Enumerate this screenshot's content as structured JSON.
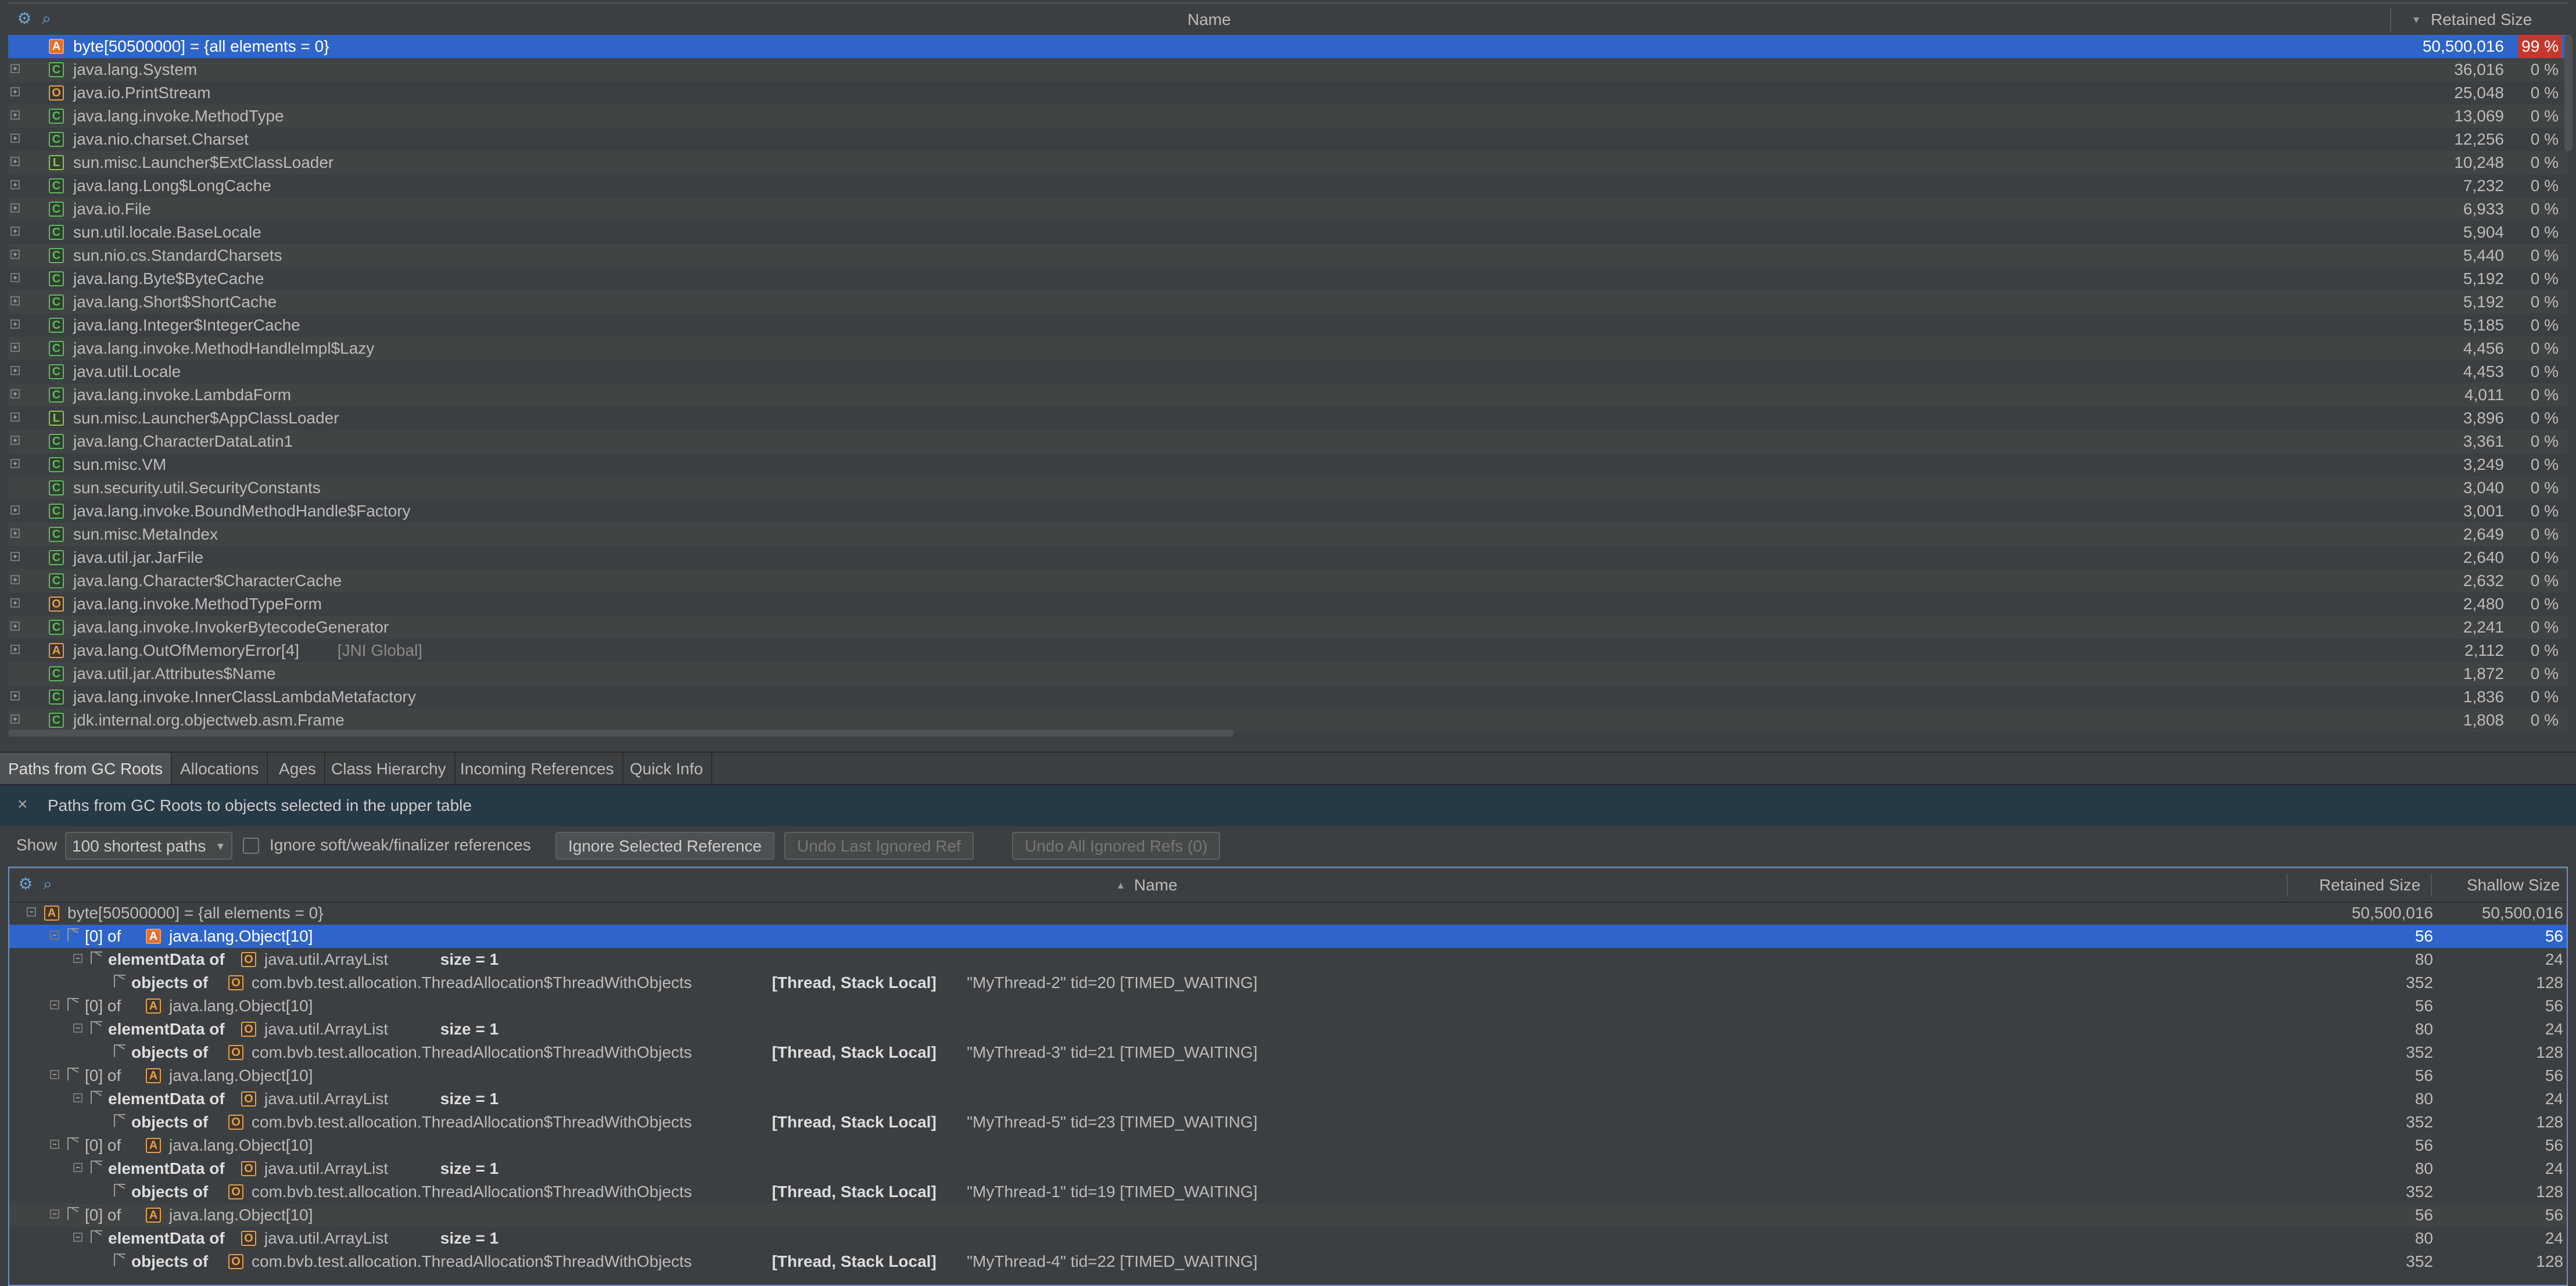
{
  "upper": {
    "header": {
      "name": "Name",
      "retained": "Retained Size",
      "sort_icon": "sort-desc-icon"
    },
    "rows": [
      {
        "kind": "A",
        "name": "byte[50500000] = {all elements = 0}",
        "tag": "",
        "size": "50,500,016",
        "pct": "99 %",
        "expander": "none",
        "selected": true
      },
      {
        "kind": "C",
        "name": "java.lang.System",
        "tag": "",
        "size": "36,016",
        "pct": "0 %",
        "expander": "plus"
      },
      {
        "kind": "O",
        "name": "java.io.PrintStream",
        "tag": "",
        "size": "25,048",
        "pct": "0 %",
        "expander": "plus"
      },
      {
        "kind": "C",
        "name": "java.lang.invoke.MethodType",
        "tag": "",
        "size": "13,069",
        "pct": "0 %",
        "expander": "plus"
      },
      {
        "kind": "C",
        "name": "java.nio.charset.Charset",
        "tag": "",
        "size": "12,256",
        "pct": "0 %",
        "expander": "plus"
      },
      {
        "kind": "L",
        "name": "sun.misc.Launcher$ExtClassLoader",
        "tag": "",
        "size": "10,248",
        "pct": "0 %",
        "expander": "plus"
      },
      {
        "kind": "C",
        "name": "java.lang.Long$LongCache",
        "tag": "",
        "size": "7,232",
        "pct": "0 %",
        "expander": "plus"
      },
      {
        "kind": "C",
        "name": "java.io.File",
        "tag": "",
        "size": "6,933",
        "pct": "0 %",
        "expander": "plus"
      },
      {
        "kind": "C",
        "name": "sun.util.locale.BaseLocale",
        "tag": "",
        "size": "5,904",
        "pct": "0 %",
        "expander": "plus"
      },
      {
        "kind": "C",
        "name": "sun.nio.cs.StandardCharsets",
        "tag": "",
        "size": "5,440",
        "pct": "0 %",
        "expander": "plus"
      },
      {
        "kind": "C",
        "name": "java.lang.Byte$ByteCache",
        "tag": "",
        "size": "5,192",
        "pct": "0 %",
        "expander": "plus"
      },
      {
        "kind": "C",
        "name": "java.lang.Short$ShortCache",
        "tag": "",
        "size": "5,192",
        "pct": "0 %",
        "expander": "plus"
      },
      {
        "kind": "C",
        "name": "java.lang.Integer$IntegerCache",
        "tag": "",
        "size": "5,185",
        "pct": "0 %",
        "expander": "plus"
      },
      {
        "kind": "C",
        "name": "java.lang.invoke.MethodHandleImpl$Lazy",
        "tag": "",
        "size": "4,456",
        "pct": "0 %",
        "expander": "plus"
      },
      {
        "kind": "C",
        "name": "java.util.Locale",
        "tag": "",
        "size": "4,453",
        "pct": "0 %",
        "expander": "plus"
      },
      {
        "kind": "C",
        "name": "java.lang.invoke.LambdaForm",
        "tag": "",
        "size": "4,011",
        "pct": "0 %",
        "expander": "plus"
      },
      {
        "kind": "L",
        "name": "sun.misc.Launcher$AppClassLoader",
        "tag": "",
        "size": "3,896",
        "pct": "0 %",
        "expander": "plus"
      },
      {
        "kind": "C",
        "name": "java.lang.CharacterDataLatin1",
        "tag": "",
        "size": "3,361",
        "pct": "0 %",
        "expander": "plus"
      },
      {
        "kind": "C",
        "name": "sun.misc.VM",
        "tag": "",
        "size": "3,249",
        "pct": "0 %",
        "expander": "plus"
      },
      {
        "kind": "C",
        "name": "sun.security.util.SecurityConstants",
        "tag": "",
        "size": "3,040",
        "pct": "0 %",
        "expander": "none"
      },
      {
        "kind": "C",
        "name": "java.lang.invoke.BoundMethodHandle$Factory",
        "tag": "",
        "size": "3,001",
        "pct": "0 %",
        "expander": "plus"
      },
      {
        "kind": "C",
        "name": "sun.misc.MetaIndex",
        "tag": "",
        "size": "2,649",
        "pct": "0 %",
        "expander": "plus"
      },
      {
        "kind": "C",
        "name": "java.util.jar.JarFile",
        "tag": "",
        "size": "2,640",
        "pct": "0 %",
        "expander": "plus"
      },
      {
        "kind": "C",
        "name": "java.lang.Character$CharacterCache",
        "tag": "",
        "size": "2,632",
        "pct": "0 %",
        "expander": "plus"
      },
      {
        "kind": "O",
        "name": "java.lang.invoke.MethodTypeForm",
        "tag": "",
        "size": "2,480",
        "pct": "0 %",
        "expander": "plus"
      },
      {
        "kind": "C",
        "name": "java.lang.invoke.InvokerBytecodeGenerator",
        "tag": "",
        "size": "2,241",
        "pct": "0 %",
        "expander": "plus"
      },
      {
        "kind": "A",
        "name": "java.lang.OutOfMemoryError[4]",
        "tag": "[JNI Global]",
        "size": "2,112",
        "pct": "0 %",
        "expander": "plus"
      },
      {
        "kind": "C",
        "name": "java.util.jar.Attributes$Name",
        "tag": "",
        "size": "1,872",
        "pct": "0 %",
        "expander": "none"
      },
      {
        "kind": "C",
        "name": "java.lang.invoke.InnerClassLambdaMetafactory",
        "tag": "",
        "size": "1,836",
        "pct": "0 %",
        "expander": "plus"
      },
      {
        "kind": "C",
        "name": "jdk.internal.org.objectweb.asm.Frame",
        "tag": "",
        "size": "1,808",
        "pct": "0 %",
        "expander": "plus"
      }
    ]
  },
  "tabs": [
    {
      "label": "Paths from GC Roots",
      "active": true
    },
    {
      "label": "Allocations",
      "active": false
    },
    {
      "label": "Ages",
      "active": false
    },
    {
      "label": "Class Hierarchy",
      "active": false
    },
    {
      "label": "Incoming References",
      "active": false
    },
    {
      "label": "Quick Info",
      "active": false
    }
  ],
  "info": {
    "close": "×",
    "text": "Paths from GC Roots to objects selected in the upper table"
  },
  "toolbar": {
    "show_label": "Show",
    "show_value": "100 shortest paths",
    "ignore_soft_label": "Ignore soft/weak/finalizer references",
    "ignore_selected": "Ignore Selected Reference",
    "undo_last": "Undo Last Ignored Ref",
    "undo_all": "Undo All Ignored Refs (0)"
  },
  "lower": {
    "header": {
      "name": "Name",
      "retained": "Retained Size",
      "shallow": "Shallow Size",
      "sort_icon": "sort-asc-icon"
    },
    "rows": [
      {
        "level": 0,
        "kind": "A",
        "field": "",
        "name": "byte[50500000] = {all elements = 0}",
        "extra": "",
        "tag": "",
        "retained": "50,500,016",
        "shallow": "50,500,016",
        "expander": "minus"
      },
      {
        "level": 1,
        "kind": "A",
        "field": "[0] of",
        "name": "java.lang.Object[10]",
        "extra": "",
        "tag": "",
        "retained": "56",
        "shallow": "56",
        "expander": "minus",
        "selected": true
      },
      {
        "level": 2,
        "kind": "O",
        "field": "elementData of",
        "name": "java.util.ArrayList",
        "extra": "size = 1",
        "tag": "",
        "retained": "80",
        "shallow": "24",
        "expander": "minus",
        "boldfield": true
      },
      {
        "level": 3,
        "kind": "O",
        "field": "objects of",
        "name": "com.bvb.test.allocation.ThreadAllocation$ThreadWithObjects",
        "extra": "",
        "tag": "[Thread, Stack Local]",
        "tail": "\"MyThread-2\" tid=20 [TIMED_WAITING]",
        "retained": "352",
        "shallow": "128",
        "expander": "none",
        "boldfield": true
      },
      {
        "level": 1,
        "kind": "A",
        "field": "[0] of",
        "name": "java.lang.Object[10]",
        "extra": "",
        "tag": "",
        "retained": "56",
        "shallow": "56",
        "expander": "minus"
      },
      {
        "level": 2,
        "kind": "O",
        "field": "elementData of",
        "name": "java.util.ArrayList",
        "extra": "size = 1",
        "tag": "",
        "retained": "80",
        "shallow": "24",
        "expander": "minus",
        "boldfield": true
      },
      {
        "level": 3,
        "kind": "O",
        "field": "objects of",
        "name": "com.bvb.test.allocation.ThreadAllocation$ThreadWithObjects",
        "extra": "",
        "tag": "[Thread, Stack Local]",
        "tail": "\"MyThread-3\" tid=21 [TIMED_WAITING]",
        "retained": "352",
        "shallow": "128",
        "expander": "none",
        "boldfield": true
      },
      {
        "level": 1,
        "kind": "A",
        "field": "[0] of",
        "name": "java.lang.Object[10]",
        "extra": "",
        "tag": "",
        "retained": "56",
        "shallow": "56",
        "expander": "minus"
      },
      {
        "level": 2,
        "kind": "O",
        "field": "elementData of",
        "name": "java.util.ArrayList",
        "extra": "size = 1",
        "tag": "",
        "retained": "80",
        "shallow": "24",
        "expander": "minus",
        "boldfield": true
      },
      {
        "level": 3,
        "kind": "O",
        "field": "objects of",
        "name": "com.bvb.test.allocation.ThreadAllocation$ThreadWithObjects",
        "extra": "",
        "tag": "[Thread, Stack Local]",
        "tail": "\"MyThread-5\" tid=23 [TIMED_WAITING]",
        "retained": "352",
        "shallow": "128",
        "expander": "none",
        "boldfield": true
      },
      {
        "level": 1,
        "kind": "A",
        "field": "[0] of",
        "name": "java.lang.Object[10]",
        "extra": "",
        "tag": "",
        "retained": "56",
        "shallow": "56",
        "expander": "minus"
      },
      {
        "level": 2,
        "kind": "O",
        "field": "elementData of",
        "name": "java.util.ArrayList",
        "extra": "size = 1",
        "tag": "",
        "retained": "80",
        "shallow": "24",
        "expander": "minus",
        "boldfield": true
      },
      {
        "level": 3,
        "kind": "O",
        "field": "objects of",
        "name": "com.bvb.test.allocation.ThreadAllocation$ThreadWithObjects",
        "extra": "",
        "tag": "[Thread, Stack Local]",
        "tail": "\"MyThread-1\" tid=19 [TIMED_WAITING]",
        "retained": "352",
        "shallow": "128",
        "expander": "none",
        "boldfield": true
      },
      {
        "level": 1,
        "kind": "A",
        "field": "[0] of",
        "name": "java.lang.Object[10]",
        "extra": "",
        "tag": "",
        "retained": "56",
        "shallow": "56",
        "expander": "minus",
        "hover": true
      },
      {
        "level": 2,
        "kind": "O",
        "field": "elementData of",
        "name": "java.util.ArrayList",
        "extra": "size = 1",
        "tag": "",
        "retained": "80",
        "shallow": "24",
        "expander": "minus",
        "boldfield": true
      },
      {
        "level": 3,
        "kind": "O",
        "field": "objects of",
        "name": "com.bvb.test.allocation.ThreadAllocation$ThreadWithObjects",
        "extra": "",
        "tag": "[Thread, Stack Local]",
        "tail": "\"MyThread-4\" tid=22 [TIMED_WAITING]",
        "retained": "352",
        "shallow": "128",
        "expander": "none",
        "boldfield": true
      }
    ]
  },
  "icons": {
    "settings": "gear-icon",
    "search": "search-icon"
  },
  "colors": {
    "selection": "#2f65ca",
    "hot_percent": "#c3382e",
    "info_bar": "#263a46"
  }
}
